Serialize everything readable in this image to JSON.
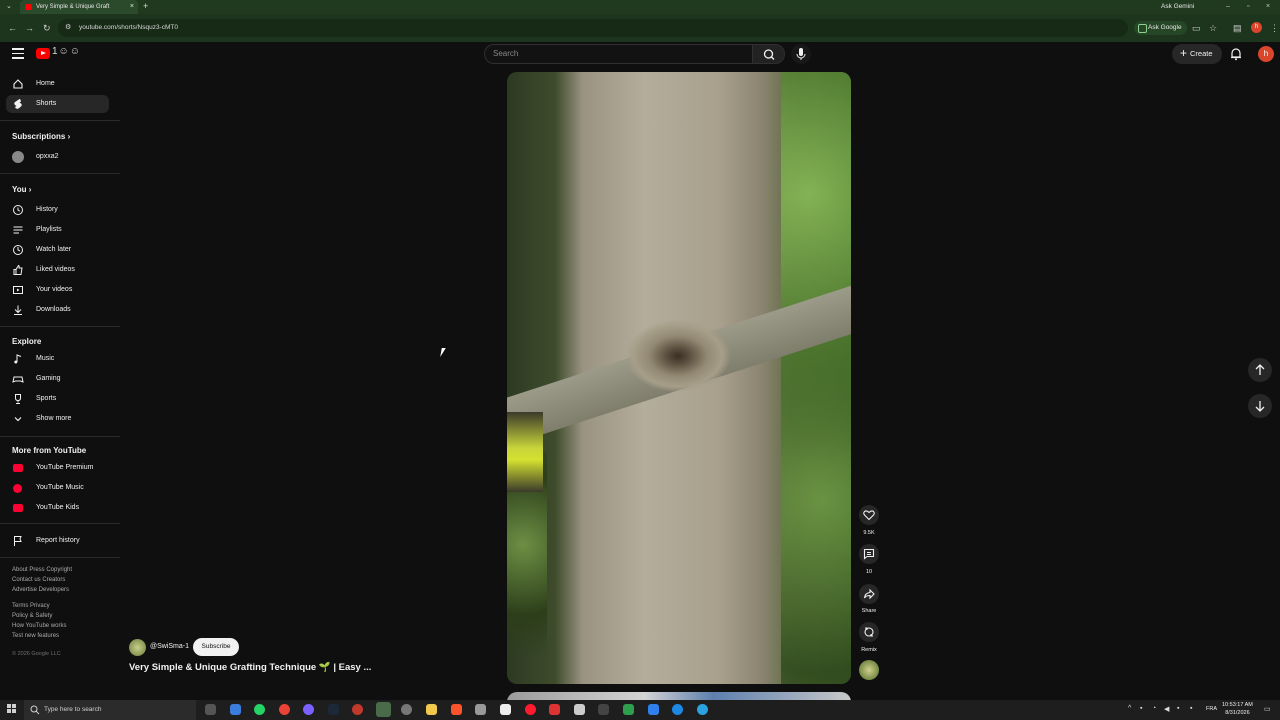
{
  "browser": {
    "tab_title": "Very Simple & Unique Graft",
    "new_tab_label": "+",
    "url": "youtube.com/shorts/Nsquz3-cMT0",
    "ask_gemini": "Ask Gemini",
    "ask_google": "Ask Google",
    "profile_initial": "h"
  },
  "header": {
    "search_placeholder": "Search",
    "create_label": "Create",
    "avatar_initial": "h",
    "doodle": "1☺☺"
  },
  "sidebar": {
    "main": [
      {
        "label": "Home",
        "icon": "home-icon"
      },
      {
        "label": "Shorts",
        "icon": "shorts-icon",
        "active": true
      }
    ],
    "subscriptions_title": "Subscriptions",
    "subscriptions": [
      {
        "label": "opxxa2"
      }
    ],
    "you_title": "You",
    "you_items": [
      {
        "label": "History",
        "icon": "history-icon"
      },
      {
        "label": "Playlists",
        "icon": "playlists-icon"
      },
      {
        "label": "Watch later",
        "icon": "clock-icon"
      },
      {
        "label": "Liked videos",
        "icon": "thumbs-up-icon"
      },
      {
        "label": "Your videos",
        "icon": "video-icon"
      },
      {
        "label": "Downloads",
        "icon": "download-icon"
      }
    ],
    "explore_title": "Explore",
    "explore_items": [
      {
        "label": "Music",
        "icon": "music-note-icon"
      },
      {
        "label": "Gaming",
        "icon": "gamepad-icon"
      },
      {
        "label": "Sports",
        "icon": "trophy-icon"
      },
      {
        "label": "Show more",
        "icon": "chevron-down-icon"
      }
    ],
    "more_title": "More from YouTube",
    "more_items": [
      {
        "label": "YouTube Premium"
      },
      {
        "label": "YouTube Music"
      },
      {
        "label": "YouTube Kids"
      }
    ],
    "report_history": "Report history",
    "footer": {
      "line1": "About  Press  Copyright",
      "line2": "Contact us  Creators",
      "line3": "Advertise  Developers",
      "line4": "Terms  Privacy",
      "line5": "Policy & Safety",
      "line6": "How YouTube works",
      "line7": "Test new features",
      "copyright": "© 2026 Google LLC"
    }
  },
  "short": {
    "channel": "@SwiSma-1",
    "subscribe_label": "Subscribe",
    "title": "Very Simple & Unique Grafting Technique 🌱 | Easy ...",
    "likes": "9.5K",
    "comments": "10",
    "share_label": "Share",
    "remix_label": "Remix"
  },
  "taskbar": {
    "search_placeholder": "Type here to search",
    "language": "FRA",
    "time": "10:53:17 AM",
    "date": "8/31/2026"
  },
  "colors": {
    "background": "#0f0f0f",
    "browser_chrome": "#1c351c",
    "youtube_red": "#ff0000"
  }
}
